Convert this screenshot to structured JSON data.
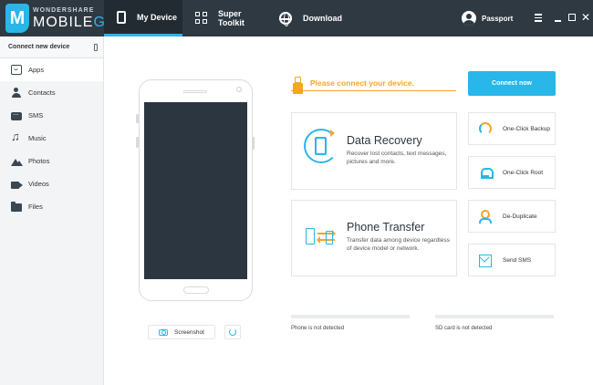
{
  "app": {
    "logo_brand": "WONDERSHARE",
    "logo_product_part1": "MOBILE",
    "logo_product_part2": "GO",
    "logo_mark": "M"
  },
  "tabs": [
    {
      "label": "My Device",
      "icon": "phone-icon",
      "active": true
    },
    {
      "label": "Super Toolkit",
      "icon": "grid-icon",
      "active": false
    },
    {
      "label": "Download",
      "icon": "globe-icon",
      "active": false
    }
  ],
  "account": {
    "label": "Passport",
    "icon": "user-icon"
  },
  "window_controls": {
    "close_glyph": "✕"
  },
  "sidebar": {
    "header": "Connect new device",
    "items": [
      {
        "label": "Apps",
        "icon": "apps-icon"
      },
      {
        "label": "Contacts",
        "icon": "contacts-icon"
      },
      {
        "label": "SMS",
        "icon": "sms-icon"
      },
      {
        "label": "Music",
        "icon": "music-icon"
      },
      {
        "label": "Photos",
        "icon": "photos-icon"
      },
      {
        "label": "Videos",
        "icon": "videos-icon"
      },
      {
        "label": "Files",
        "icon": "files-icon"
      }
    ]
  },
  "device_actions": {
    "screenshot_label": "Screenshot"
  },
  "notice": {
    "text": "Please connect your device.",
    "button": "Connect now"
  },
  "features": {
    "recovery": {
      "title": "Data Recovery",
      "desc": "Recover lost contacts, text messages, pictures and more."
    },
    "transfer": {
      "title": "Phone Transfer",
      "desc": "Transfer data among device regardless of device model or network."
    }
  },
  "tools": [
    {
      "label": "One-Click Backup",
      "icon": "backup-icon"
    },
    {
      "label": "One-Click Root",
      "icon": "android-icon"
    },
    {
      "label": "De-Duplicate",
      "icon": "deduplicate-icon"
    },
    {
      "label": "Send SMS",
      "icon": "envelope-icon"
    }
  ],
  "status": {
    "phone": "Phone is not detected",
    "sd": "SD card is not detected"
  },
  "colors": {
    "topbar": "#2f3942",
    "accent": "#29b6e8",
    "warning": "#f5a623",
    "sidebar": "#f2f4f6"
  }
}
